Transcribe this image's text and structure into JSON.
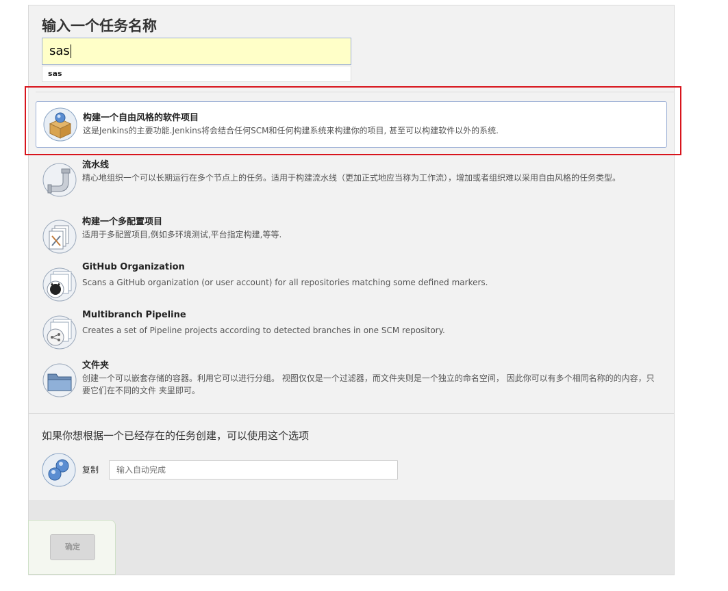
{
  "header": {
    "title": "输入一个任务名称"
  },
  "name_field": {
    "value": "sas",
    "suggestion": "sas"
  },
  "items": [
    {
      "label": "构建一个自由风格的软件项目",
      "desc": "这是Jenkins的主要功能.Jenkins将会结合任何SCM和任何构建系统来构建你的项目, 甚至可以构建软件以外的系统.",
      "icon": "freestyle-project-icon"
    },
    {
      "label": "流水线",
      "desc": "精心地组织一个可以长期运行在多个节点上的任务。适用于构建流水线（更加正式地应当称为工作流），增加或者组织难以采用自由风格的任务类型。",
      "icon": "pipeline-icon"
    },
    {
      "label": "构建一个多配置项目",
      "desc": "适用于多配置项目,例如多环境测试,平台指定构建,等等.",
      "icon": "multi-config-icon"
    },
    {
      "label": "GitHub Organization",
      "desc": "Scans a GitHub organization (or user account) for all repositories matching some defined markers.",
      "icon": "github-icon"
    },
    {
      "label": "Multibranch Pipeline",
      "desc": "Creates a set of Pipeline projects according to detected branches in one SCM repository.",
      "icon": "multibranch-icon"
    },
    {
      "label": "文件夹",
      "desc": "创建一个可以嵌套存储的容器。利用它可以进行分组。 视图仅仅是一个过滤器，而文件夹则是一个独立的命名空间， 因此你可以有多个相同名称的的内容，只要它们在不同的文件 夹里即可。",
      "icon": "folder-icon"
    }
  ],
  "copy_section": {
    "heading": "如果你想根据一个已经存在的任务创建，可以使用这个选项",
    "label": "复制",
    "placeholder": "输入自动完成"
  },
  "ok_button": {
    "label": "确定"
  },
  "colors": {
    "highlight": "#d8141c",
    "input_bg": "#ffffc8",
    "selected_border": "#9db0d6"
  }
}
